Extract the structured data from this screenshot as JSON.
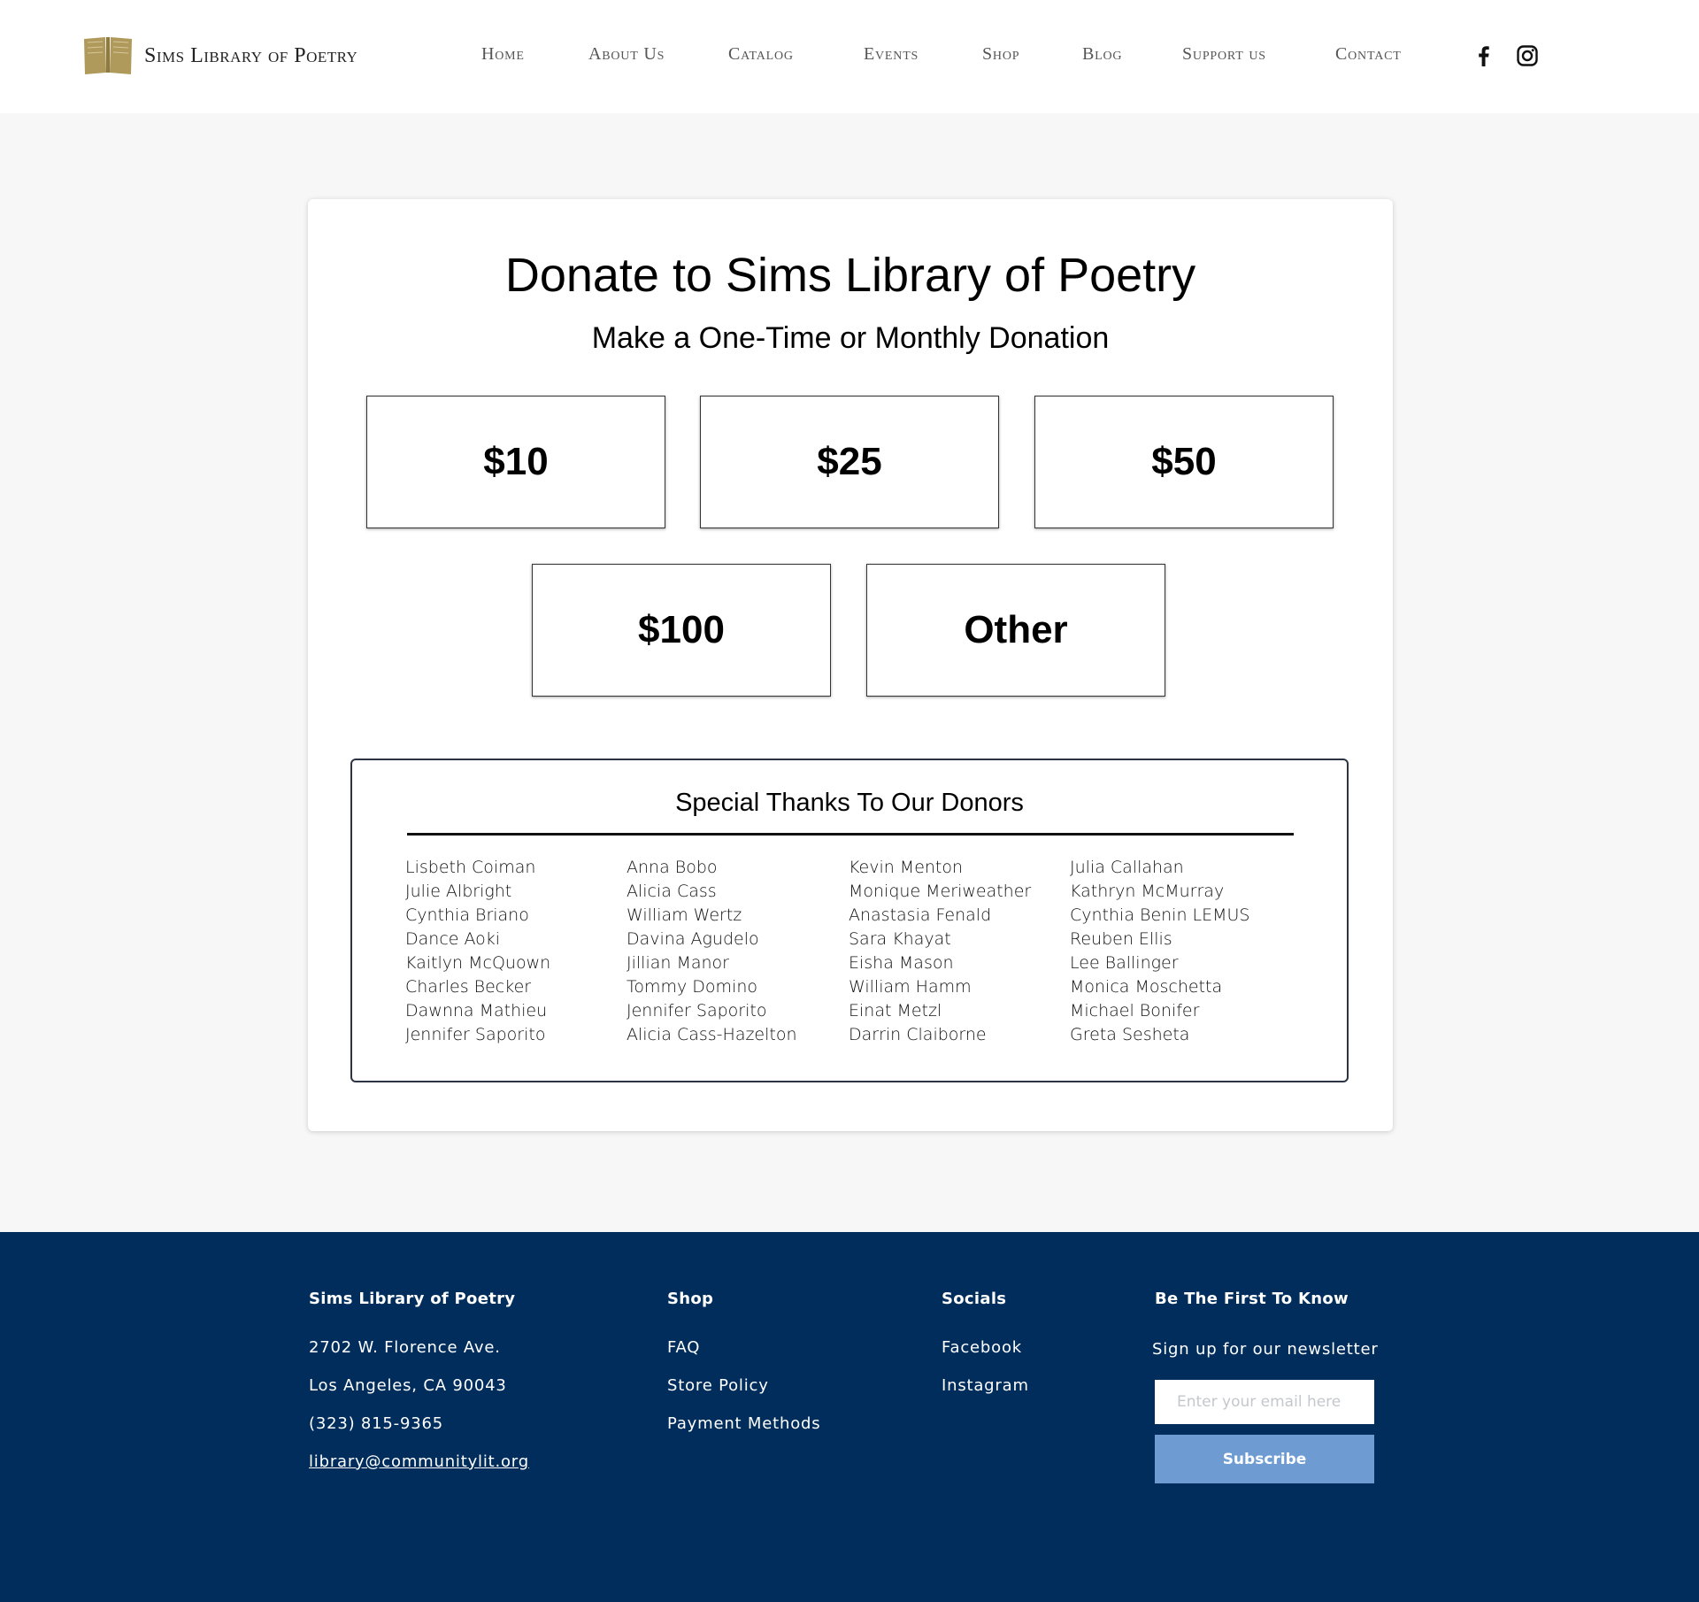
{
  "header": {
    "logo_text": "Sims Library of Poetry",
    "logo_icon": "open-book-icon",
    "nav": [
      "Home",
      "About Us",
      "Catalog",
      "Events",
      "Shop",
      "Blog",
      "Support us",
      "Contact"
    ],
    "socials": [
      "facebook-icon",
      "instagram-icon"
    ]
  },
  "card": {
    "title": "Donate to Sims Library of Poetry",
    "subtitle": "Make a One-Time or Monthly Donation",
    "amounts": [
      "$10",
      "$25",
      "$50",
      "$100",
      "Other"
    ]
  },
  "donors": {
    "title": "Special Thanks To Our Donors",
    "columns": [
      [
        "Lisbeth Coiman",
        "Julie Albright",
        "Cynthia Briano",
        "Dance Aoki",
        "Kaitlyn McQuown",
        "Charles Becker",
        "Dawnna Mathieu",
        "Jennifer Saporito"
      ],
      [
        "Anna Bobo",
        "Alicia Cass",
        "William Wertz",
        "Davina Agudelo",
        "Jillian Manor",
        "Tommy Domino",
        "Jennifer Saporito",
        "Alicia Cass-Hazelton"
      ],
      [
        "Kevin Menton",
        "Monique Meriweather",
        "Anastasia Fenald",
        "Sara Khayat",
        "Eisha Mason",
        "William Hamm",
        "Einat Metzl",
        "Darrin Claiborne"
      ],
      [
        "Julia Callahan",
        "Kathryn McMurray",
        "Cynthia Benin LEMUS",
        "Reuben Ellis",
        "Lee Ballinger",
        "Monica Moschetta",
        "Michael Bonifer",
        "Greta Sesheta"
      ]
    ]
  },
  "footer": {
    "org": {
      "heading": "Sims Library of Poetry",
      "address1": "2702 W. Florence Ave.",
      "address2": "Los Angeles, CA 90043",
      "phone": "(323) 815-9365",
      "email": "library@communitylit.org"
    },
    "shop": {
      "heading": "Shop",
      "links": [
        "FAQ",
        "Store Policy",
        "Payment Methods"
      ]
    },
    "socials": {
      "heading": "Socials",
      "links": [
        "Facebook",
        "Instagram"
      ]
    },
    "newsletter": {
      "heading": "Be The First To Know",
      "text": "Sign up for our newsletter",
      "placeholder": "Enter your email here",
      "button": "Subscribe"
    }
  },
  "colors": {
    "logo_gold": "#b09a5b",
    "footer_bg": "#002d5c",
    "subscribe_bg": "#6e9cd2",
    "page_bg": "#f7f7f7"
  }
}
